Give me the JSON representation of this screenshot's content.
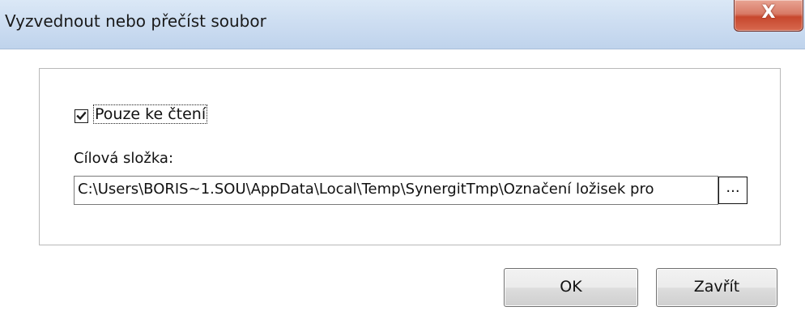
{
  "window": {
    "title": "Vyzvednout nebo přečíst soubor",
    "close_glyph": "X"
  },
  "options": {
    "readonly_label": "Pouze ke čtení",
    "readonly_checked": true
  },
  "target_folder": {
    "label": "Cílová složka:",
    "value": "C:\\Users\\BORIS~1.SOU\\AppData\\Local\\Temp\\SynergitTmp\\Označení ložisek pro",
    "browse_label": "..."
  },
  "buttons": {
    "ok_label": "OK",
    "close_label": "Zavřít"
  },
  "icons": {
    "close": "close-icon",
    "checkmark": "checkmark-icon"
  }
}
